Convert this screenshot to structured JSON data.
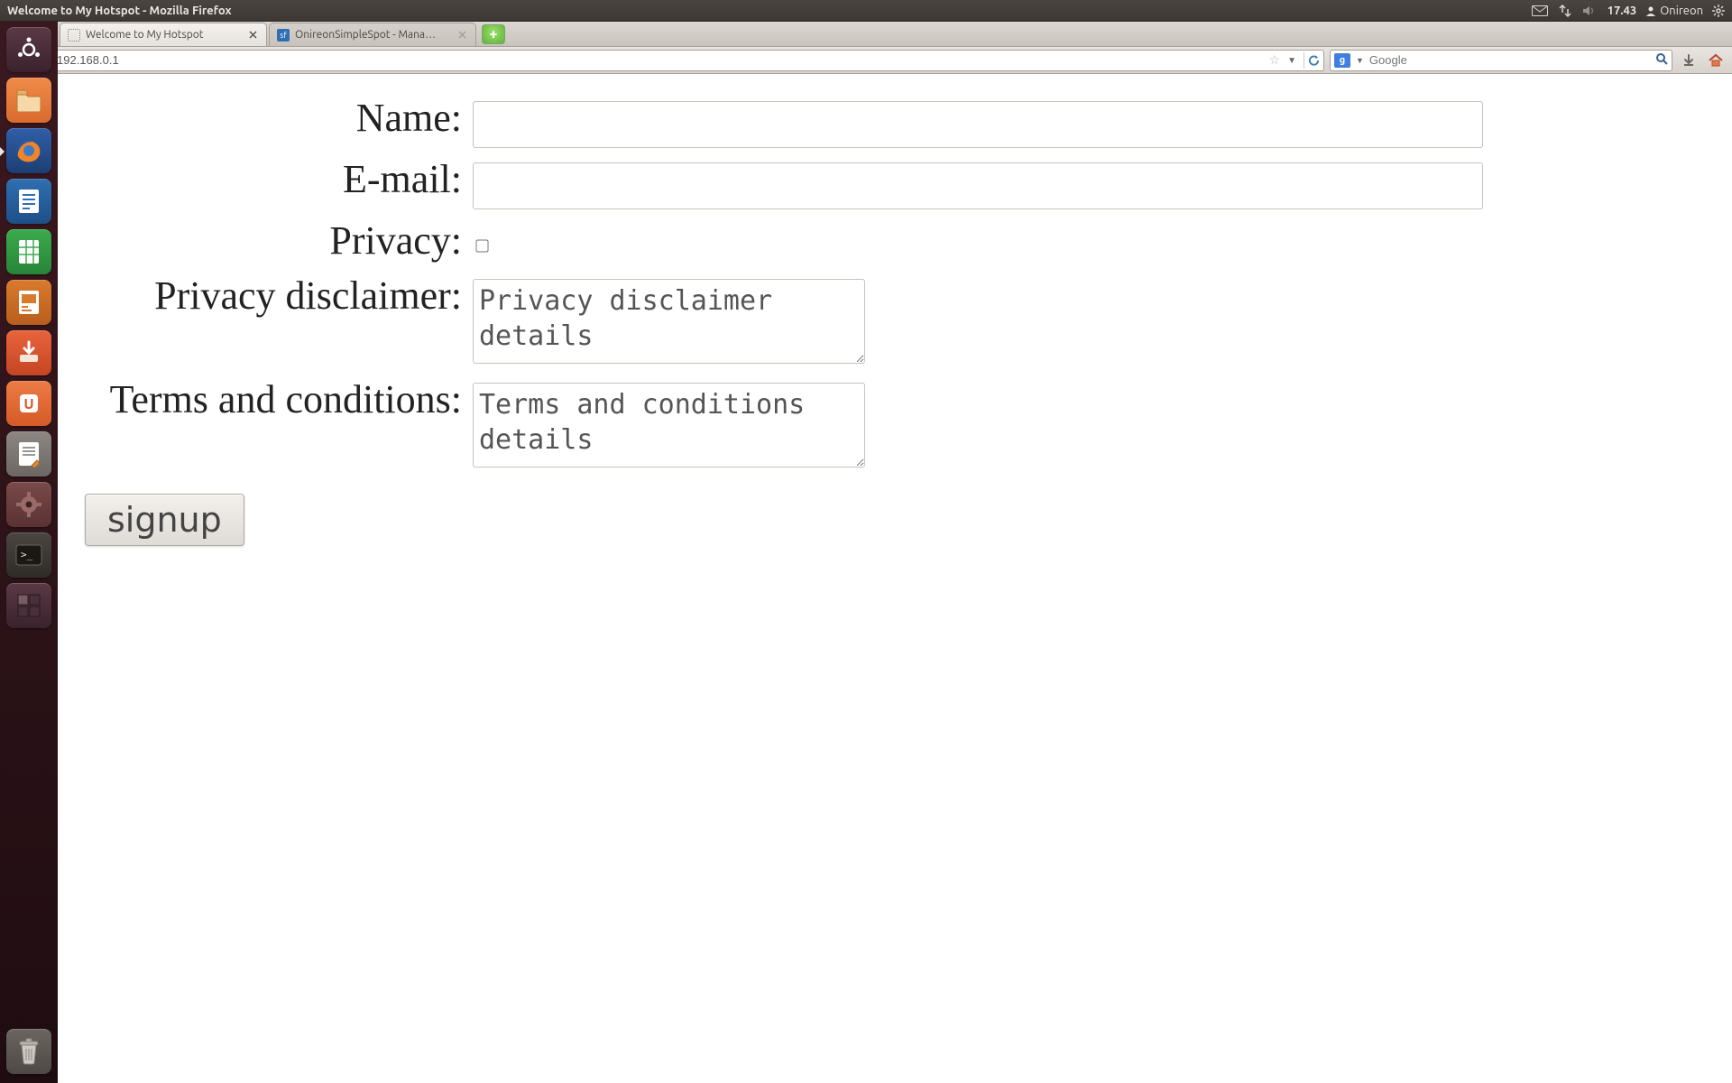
{
  "window_title": "Welcome to My Hotspot - Mozilla Firefox",
  "menubar": {
    "time": "17.43",
    "user": "Onireon"
  },
  "tabs": [
    {
      "label": "Welcome to My Hotspot",
      "active": true
    },
    {
      "label": "OnireonSimpleSpot - Mana…",
      "active": false
    }
  ],
  "url": "192.168.0.1",
  "search": {
    "placeholder": "Google"
  },
  "form": {
    "name_label": "Name:",
    "email_label": "E-mail:",
    "privacy_label": "Privacy:",
    "disclaimer_label": "Privacy disclaimer:",
    "terms_label": "Terms and conditions:",
    "name_value": "",
    "email_value": "",
    "privacy_checked": false,
    "disclaimer_value": "Privacy disclaimer details",
    "terms_value": "Terms and conditions details",
    "submit_label": "signup"
  },
  "launcher_items": [
    "dash",
    "files",
    "firefox",
    "writer",
    "calc",
    "impress",
    "software-updater",
    "ubuntu-one",
    "text-editor",
    "settings",
    "terminal",
    "workspace-switcher"
  ]
}
